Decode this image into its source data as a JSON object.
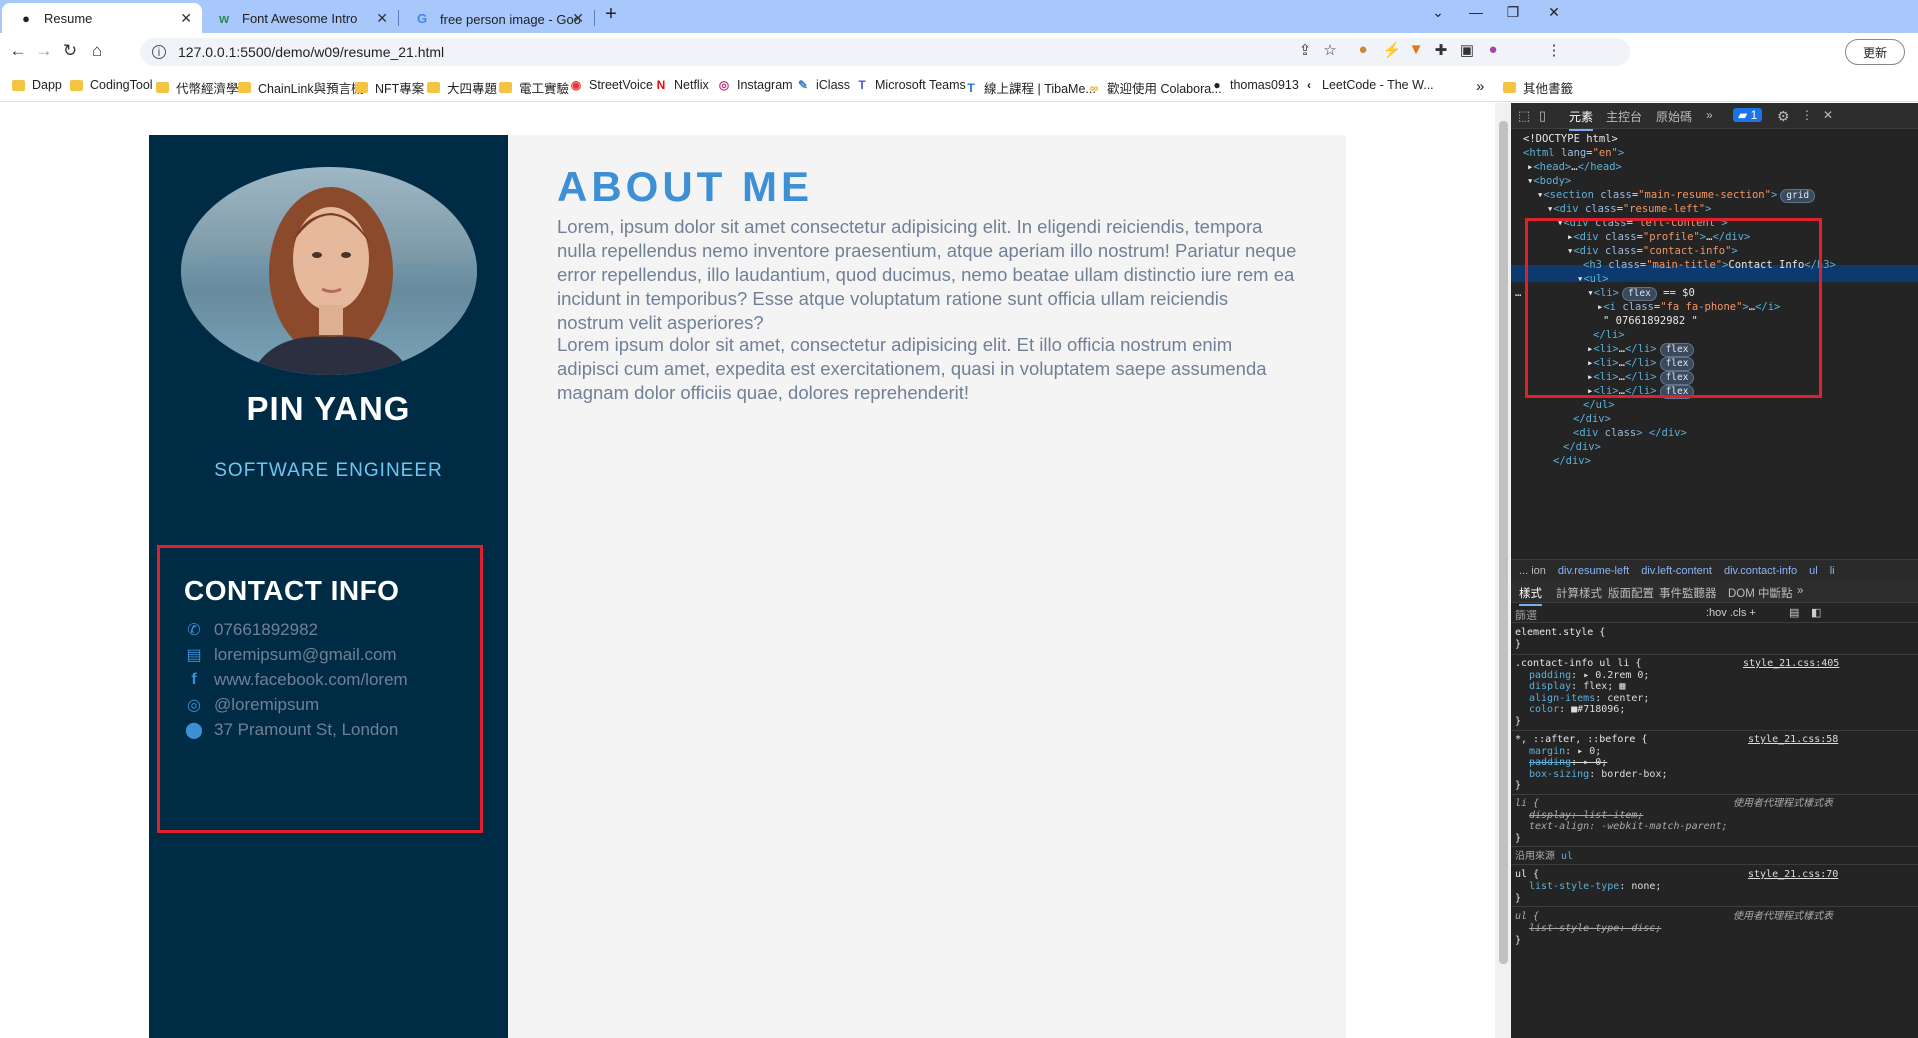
{
  "browser": {
    "tabs": [
      {
        "title": "Resume"
      },
      {
        "title": "Font Awesome Intro"
      },
      {
        "title": "free person image - Google 搜尋"
      }
    ],
    "new_tab": "+",
    "url": "127.0.0.1:5500/demo/w09/resume_21.html",
    "update_label": "更新",
    "bookmarks": [
      "Dapp",
      "CodingTool",
      "代幣經濟學",
      "ChainLink與預言機",
      "NFT專案",
      "大四專題",
      "電工實驗",
      "StreetVoice",
      "Netflix",
      "Instagram",
      "iClass",
      "Microsoft Teams",
      "線上課程 | TibaMe...",
      "歡迎使用 Colabora...",
      "thomas0913",
      "LeetCode - The W..."
    ],
    "bookmarks_more": "»",
    "other_bookmarks": "其他書籤"
  },
  "resume": {
    "name": "PIN YANG",
    "role": "SOFTWARE ENGINEER",
    "contact_title": "CONTACT INFO",
    "contacts": [
      {
        "icon": "phone-icon",
        "text": "07661892982"
      },
      {
        "icon": "fax-icon",
        "text": "loremipsum@gmail.com"
      },
      {
        "icon": "facebook-icon",
        "text": "www.facebook.com/lorem"
      },
      {
        "icon": "instagram-icon",
        "text": "@loremipsum"
      },
      {
        "icon": "map-marker-icon",
        "text": "37 Pramount St, London"
      }
    ],
    "about_title": "ABOUT ME",
    "about_p1": "Lorem, ipsum dolor sit amet consectetur adipisicing elit. In eligendi reiciendis, tempora nulla repellendus nemo inventore praesentium, atque aperiam illo nostrum! Pariatur neque error repellendus, illo laudantium, quod ducimus, nemo beatae ullam distinctio iure rem ea incidunt in temporibus? Esse atque voluptatum ratione sunt officia ullam reiciendis nostrum velit asperiores?",
    "about_p2": "Lorem ipsum dolor sit amet, consectetur adipisicing elit. Et illo officia nostrum enim adipisci cum amet, expedita est exercitationem, quasi in voluptatem saepe assumenda magnam dolor officiis quae, dolores reprehenderit!"
  },
  "devtools": {
    "tabs": [
      "元素",
      "主控台",
      "原始碼",
      "»"
    ],
    "issues_badge": "1",
    "breadcrumbs": [
      "... ion",
      "div.resume-left",
      "div.left-content",
      "div.contact-info",
      "ul",
      "li"
    ],
    "style_tabs": [
      "樣式",
      "計算樣式",
      "版面配置",
      "事件監聽器",
      "DOM 中斷點",
      "»"
    ],
    "filter_placeholder": "篩選",
    "filter_tools": ":hov  .cls  +",
    "inherited_label": "沿用來源",
    "inherited_from": "ul"
  },
  "colors": {
    "sidebar": "#002b45",
    "accent": "#3d8fd6",
    "text": "#718096",
    "highlight_box": "#e0212d"
  }
}
